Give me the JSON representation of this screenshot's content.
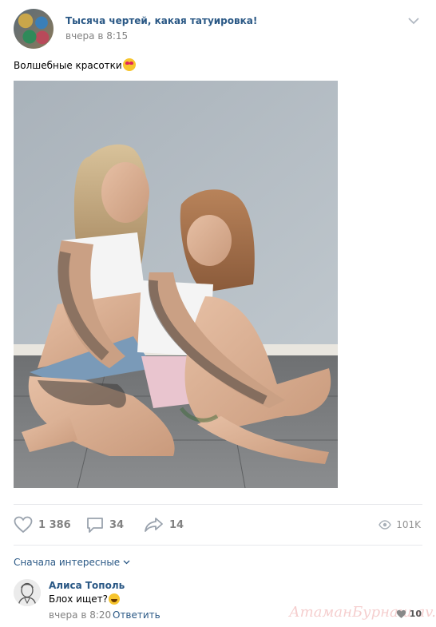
{
  "post": {
    "group_name": "Тысяча чертей, какая татуировка!",
    "time": "вчера в 8:15",
    "text": "Волшебные красотки",
    "emoji_icon": "heart-eyes-emoji-icon",
    "photo_icon": "photo-two-tattooed-women"
  },
  "actions": {
    "likes": "1 386",
    "comments": "34",
    "shares": "14",
    "views": "101K"
  },
  "comments": {
    "sort_label": "Сначала интересные",
    "items": [
      {
        "author": "Алиса Тополь",
        "text": "Блох ищет?",
        "time": "вчера в 8:20",
        "reply_label": "Ответить",
        "likes": "10"
      }
    ]
  },
  "watermark": "АтаманБурнаш av.ru",
  "colors": {
    "link": "#2a5885",
    "muted": "#828282",
    "separator": "#e7e8ec"
  }
}
